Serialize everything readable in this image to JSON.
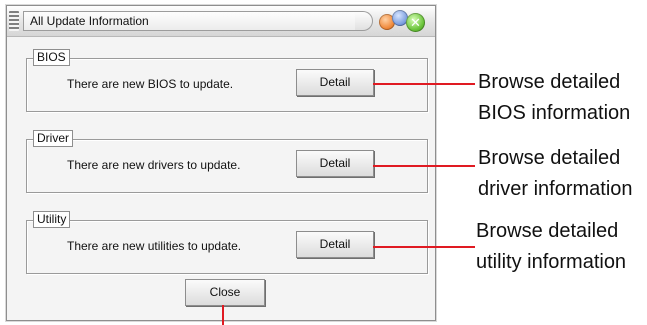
{
  "window": {
    "title": "All Update Information",
    "close_glyph": "✕"
  },
  "groups": [
    {
      "label": "BIOS",
      "message": "There are new BIOS to update.",
      "button": "Detail"
    },
    {
      "label": "Driver",
      "message": "There are new drivers to update.",
      "button": "Detail"
    },
    {
      "label": "Utility",
      "message": "There are new utilities to update.",
      "button": "Detail"
    }
  ],
  "close_button": "Close",
  "callouts": [
    {
      "line1": "Browse detailed",
      "line2": "BIOS information"
    },
    {
      "line1": "Browse detailed",
      "line2": "driver information"
    },
    {
      "line1": "Browse detailed",
      "line2": "utility information"
    }
  ],
  "colors": {
    "pointer": "#e01a22",
    "window_bg": "#f4f4f4"
  }
}
